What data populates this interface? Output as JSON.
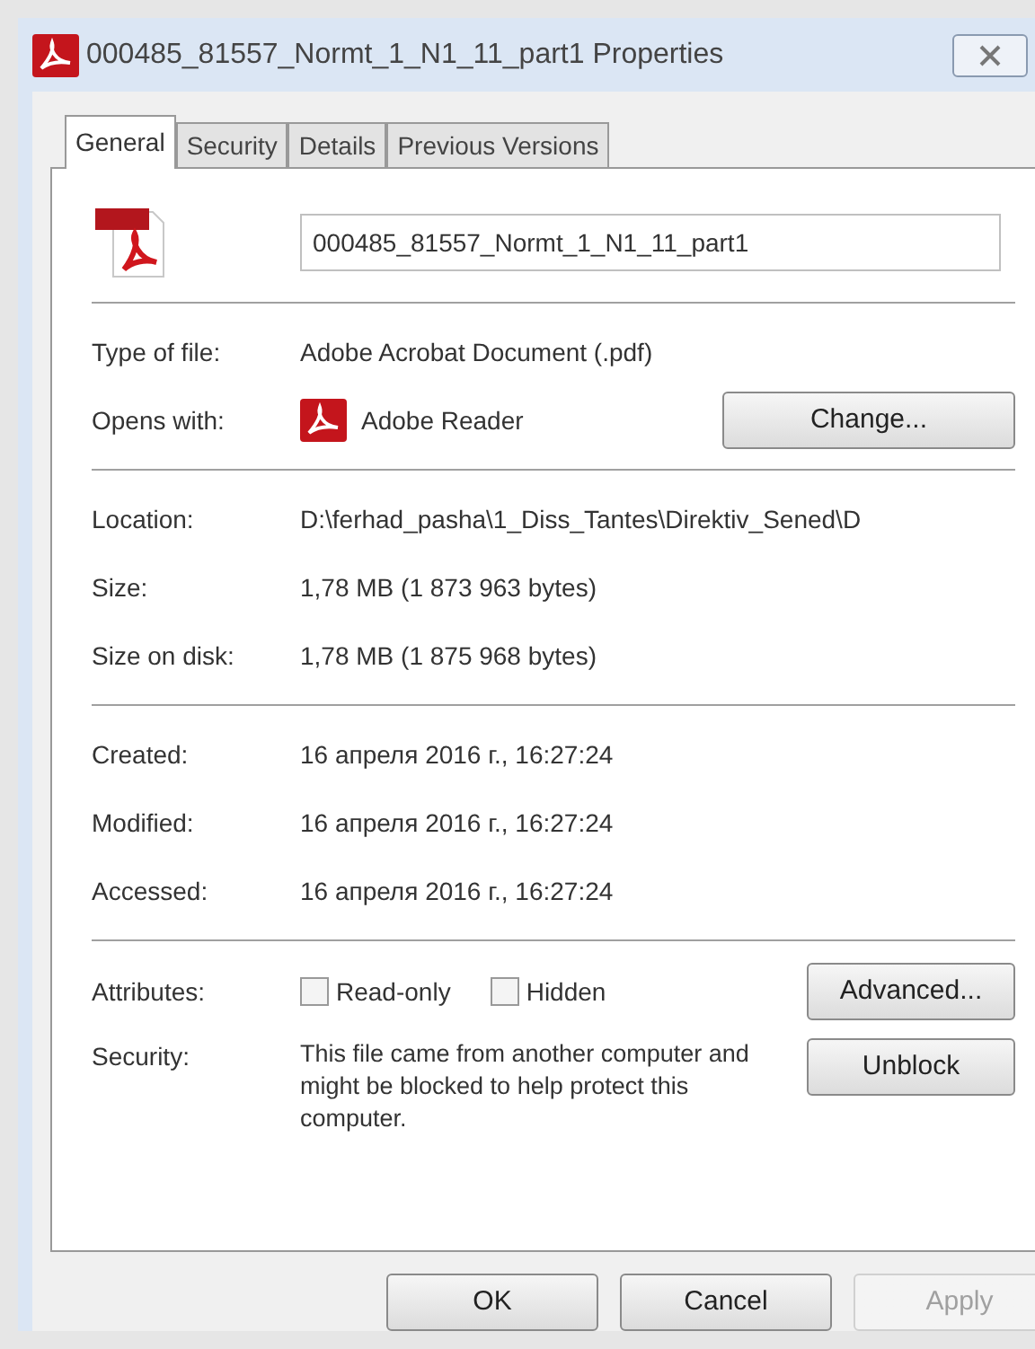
{
  "window": {
    "title": "000485_81557_Normt_1_N1_11_part1 Properties"
  },
  "tabs": [
    {
      "label": "General",
      "selected": true
    },
    {
      "label": "Security",
      "selected": false
    },
    {
      "label": "Details",
      "selected": false
    },
    {
      "label": "Previous Versions",
      "selected": false
    }
  ],
  "file_name": "000485_81557_Normt_1_N1_11_part1",
  "type_section": [
    {
      "label": "Type of file:",
      "value": "Adobe Acrobat Document (.pdf)"
    },
    {
      "label": "Opens with:",
      "value": "Adobe Reader",
      "button": "Change..."
    }
  ],
  "location_section": [
    {
      "label": "Location:",
      "value": "D:\\ferhad_pasha\\1_Diss_Tantes\\Direktiv_Sened\\D"
    },
    {
      "label": "Size:",
      "value": "1,78 MB (1 873 963 bytes)"
    },
    {
      "label": "Size on disk:",
      "value": "1,78 MB (1 875 968 bytes)"
    }
  ],
  "dates_section": [
    {
      "label": "Created:",
      "value": "16 апреля 2016 г., 16:27:24"
    },
    {
      "label": "Modified:",
      "value": "16 апреля 2016 г., 16:27:24"
    },
    {
      "label": "Accessed:",
      "value": "16 апреля 2016 г., 16:27:24"
    }
  ],
  "attributes": {
    "label": "Attributes:",
    "checkboxes": [
      {
        "label": "Read-only",
        "checked": false
      },
      {
        "label": "Hidden",
        "checked": false
      }
    ],
    "button": "Advanced..."
  },
  "security": {
    "label": "Security:",
    "text": "This file came from another computer and might be blocked to help protect this computer.",
    "button": "Unblock"
  },
  "buttons": [
    {
      "label": "OK",
      "disabled": false
    },
    {
      "label": "Cancel",
      "disabled": false
    },
    {
      "label": "Apply",
      "disabled": true
    }
  ]
}
